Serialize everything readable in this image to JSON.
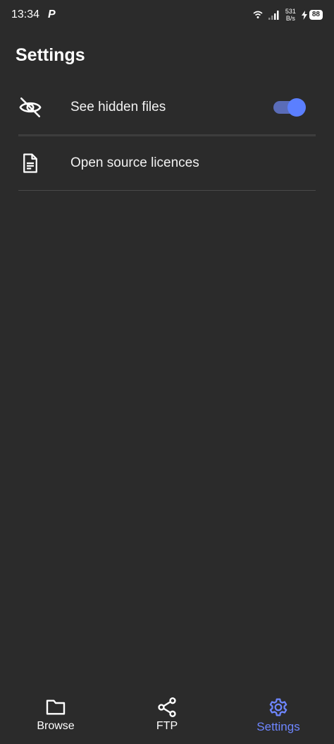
{
  "status_bar": {
    "time": "13:34",
    "app_badge": "P",
    "net_speed_value": "531",
    "net_speed_unit": "B/s",
    "battery_level": "88"
  },
  "page": {
    "title": "Settings"
  },
  "settings": {
    "hidden_files_label": "See hidden files",
    "hidden_files_enabled": true,
    "licences_label": "Open source licences"
  },
  "nav": {
    "items": [
      {
        "label": "Browse",
        "icon": "folder-icon"
      },
      {
        "label": "FTP",
        "icon": "share-icon"
      },
      {
        "label": "Settings",
        "icon": "gear-icon"
      }
    ],
    "active_index": 2
  },
  "colors": {
    "background": "#2b2b2b",
    "accent": "#6e86ff",
    "toggle_thumb": "#5b7fff",
    "toggle_track": "#5a6cb8"
  }
}
